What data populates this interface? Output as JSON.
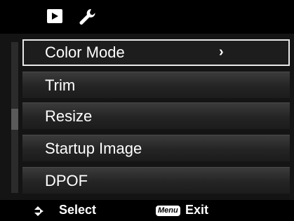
{
  "tabs": [
    {
      "icon": "playback-icon",
      "active": true
    },
    {
      "icon": "wrench-icon",
      "active": false
    }
  ],
  "menu": {
    "items": [
      {
        "label": "Color Mode",
        "arrow": "›",
        "selected": true
      },
      {
        "label": "Trim"
      },
      {
        "label": "Resize"
      },
      {
        "label": "Startup Image"
      },
      {
        "label": "DPOF"
      }
    ]
  },
  "footer": {
    "select_label": "Select",
    "menu_badge": "Menu",
    "exit_label": "Exit"
  },
  "colors": {
    "selection_border": "#e8e8e8",
    "item_bg": "#242424",
    "background": "#000000"
  }
}
